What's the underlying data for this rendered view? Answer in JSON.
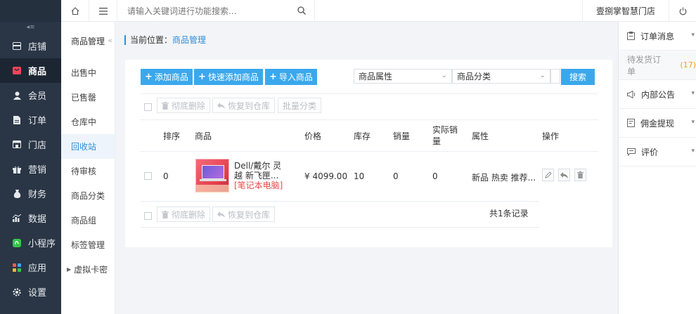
{
  "topbar": {
    "search_placeholder": "请输入关键词进行功能搜索...",
    "store_name": "壹捌掌智慧门店"
  },
  "sidebar": {
    "items": [
      {
        "label": "店铺",
        "icon": "store-icon"
      },
      {
        "label": "商品",
        "icon": "product-icon",
        "active": true
      },
      {
        "label": "会员",
        "icon": "member-icon"
      },
      {
        "label": "订单",
        "icon": "order-icon"
      },
      {
        "label": "门店",
        "icon": "shop-icon"
      },
      {
        "label": "营销",
        "icon": "gift-icon"
      },
      {
        "label": "财务",
        "icon": "money-bag-icon"
      },
      {
        "label": "数据",
        "icon": "chart-icon"
      },
      {
        "label": "小程序",
        "icon": "mini-program-icon"
      },
      {
        "label": "应用",
        "icon": "apps-icon"
      },
      {
        "label": "设置",
        "icon": "gear-icon"
      }
    ]
  },
  "subnav": {
    "title": "商品管理",
    "items": [
      {
        "label": "出售中"
      },
      {
        "label": "已售罄"
      },
      {
        "label": "仓库中"
      },
      {
        "label": "回收站",
        "active": true
      },
      {
        "label": "待审核"
      },
      {
        "label": "商品分类"
      },
      {
        "label": "商品组"
      },
      {
        "label": "标签管理"
      },
      {
        "label": "虚拟卡密"
      }
    ]
  },
  "breadcrumb": {
    "prefix": "当前位置：",
    "current": "商品管理"
  },
  "toolbar": {
    "add_label": "添加商品",
    "quick_add_label": "快速添加商品",
    "import_label": "导入商品",
    "attr_select": "商品属性",
    "category_select": "商品分类",
    "search_label": "搜索"
  },
  "bulk": {
    "delete_label": "彻底删除",
    "restore_label": "恢复到仓库",
    "batch_category_label": "批量分类"
  },
  "table": {
    "headers": [
      "排序",
      "商品",
      "价格",
      "库存",
      "销量",
      "实际销量",
      "属性",
      "操作"
    ],
    "rows": [
      {
        "sort": "0",
        "name": "Dell/戴尔 灵越 新飞匣...",
        "category": "[笔记本电脑]",
        "price": "¥ 4099.00",
        "stock": "10",
        "sales": "0",
        "actual_sales": "0",
        "attrs": "新品 热卖 推荐..."
      }
    ]
  },
  "footer": {
    "delete_label": "彻底删除",
    "restore_label": "恢复到仓库",
    "total": "共1条记录"
  },
  "rpanel": {
    "order_msg": "订单消息",
    "pending_ship": "待发货订单",
    "pending_count": "(17)",
    "notice": "内部公告",
    "commission": "佣金提现",
    "review": "评价"
  },
  "colors": {
    "primary": "#3ba8ec",
    "sidebar_bg": "#2a3645",
    "link": "#2d8ed8",
    "danger": "#e84b4b"
  }
}
